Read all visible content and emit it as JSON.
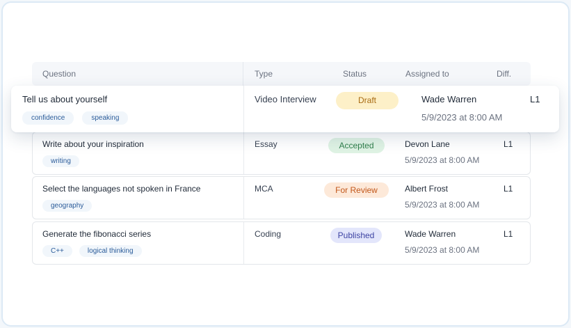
{
  "table": {
    "columns": {
      "question": "Question",
      "type": "Type",
      "status": "Status",
      "assigned_to": "Assigned to",
      "difficulty": "Diff."
    },
    "highlighted_row": {
      "question": "Tell us about yourself",
      "tags": [
        "confidence",
        "speaking"
      ],
      "type": "Video Interview",
      "status": "Draft",
      "status_color": "#fdf0c8",
      "assignee": "Wade Warren",
      "date": "5/9/2023 at 8:00 AM",
      "difficulty": "L1"
    },
    "rows": [
      {
        "question": "Write about your inspiration",
        "tags": [
          "writing"
        ],
        "type": "Essay",
        "status": "Accepted",
        "status_color": "#dff3e4",
        "assignee": "Devon Lane",
        "date": "5/9/2023 at 8:00 AM",
        "difficulty": "L1"
      },
      {
        "question": "Select the languages not spoken in France",
        "tags": [
          "geography"
        ],
        "type": "MCA",
        "status": "For Review",
        "status_color": "#fde9d9",
        "assignee": "Albert Frost",
        "date": "5/9/2023 at 8:00 AM",
        "difficulty": "L1"
      },
      {
        "question": "Generate the fibonacci series",
        "tags": [
          "C++",
          "logical thinking"
        ],
        "type": "Coding",
        "status": "Published",
        "status_color": "#e3e6fb",
        "assignee": "Wade Warren",
        "date": "5/9/2023 at 8:00 AM",
        "difficulty": "L1"
      }
    ]
  }
}
